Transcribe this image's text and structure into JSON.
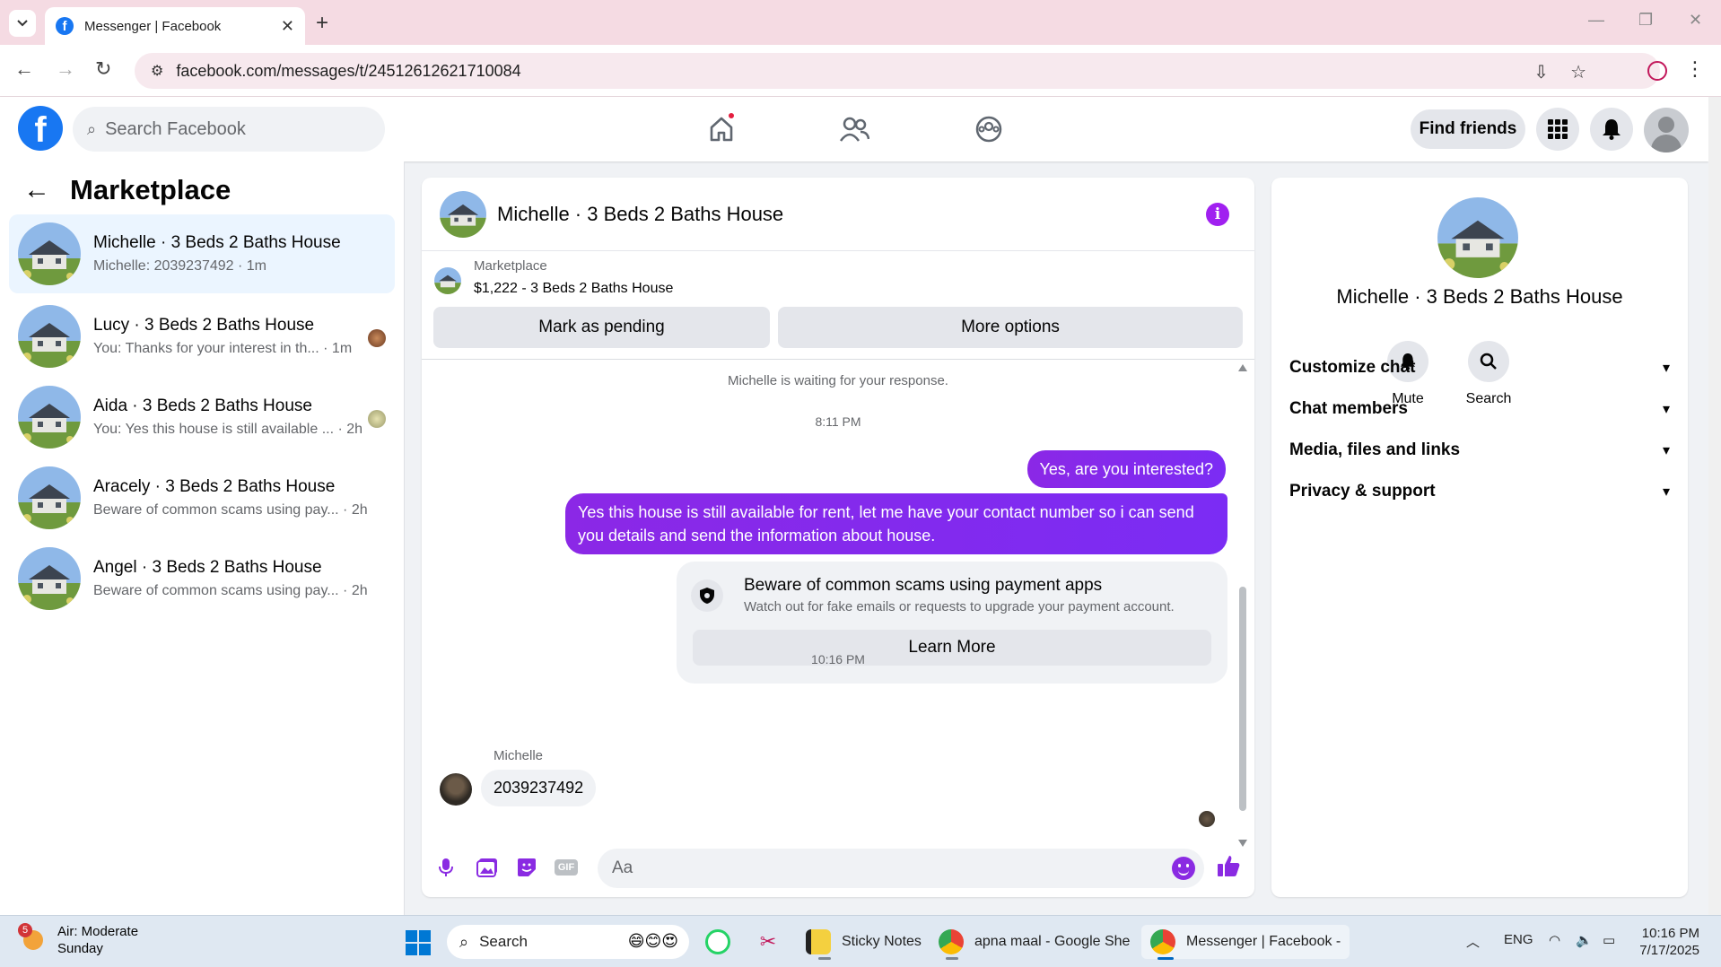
{
  "browser": {
    "tab_title": "Messenger | Facebook",
    "url": "facebook.com/messages/t/24512612621710084",
    "new_tab_glyph": "+",
    "close_glyph": "✕"
  },
  "fb_header": {
    "logo_letter": "f",
    "search_placeholder": "Search Facebook",
    "find_friends": "Find friends"
  },
  "sidebar": {
    "title": "Marketplace",
    "conversations": [
      {
        "name": "Michelle · 3 Beds 2 Baths House",
        "preview": "Michelle: 2039237492 · 1m",
        "active": true
      },
      {
        "name": "Lucy · 3 Beds 2 Baths House",
        "preview": "You: Thanks for your interest in th...",
        "time": "· 1m"
      },
      {
        "name": "Aida · 3 Beds 2 Baths House",
        "preview": "You: Yes this house is still available ...",
        "time": "· 2h"
      },
      {
        "name": "Aracely · 3 Beds 2 Baths House",
        "preview": "Beware of common scams using pay...",
        "time": "· 2h"
      },
      {
        "name": "Angel · 3 Beds 2 Baths House",
        "preview": "Beware of common scams using pay...",
        "time": "· 2h"
      }
    ]
  },
  "chat": {
    "title": "Michelle · 3 Beds 2 Baths House",
    "marketplace_label": "Marketplace",
    "listing": "$1,222 - 3 Beds 2 Baths House",
    "mark_pending": "Mark as pending",
    "more_options": "More options",
    "waiting_note": "Michelle is waiting for your response.",
    "time1": "8:11 PM",
    "msg_out_1": "Yes, are you interested?",
    "msg_out_2": "Yes this house is still available for rent, let me have your contact number so i can send you details and send the information about house.",
    "scam_title": "Beware of common scams using payment apps",
    "scam_sub": "Watch out for fake emails or requests to upgrade your payment account.",
    "learn_more": "Learn More",
    "time2": "10:16 PM",
    "sender": "Michelle",
    "msg_in": "2039237492",
    "composer_placeholder": "Aa",
    "info_glyph": "i"
  },
  "right_panel": {
    "name": "Michelle · 3 Beds 2 Baths House",
    "mute": "Mute",
    "search": "Search",
    "items": [
      "Customize chat",
      "Chat members",
      "Media, files and links",
      "Privacy & support"
    ]
  },
  "taskbar": {
    "weather_title": "Air: Moderate",
    "weather_sub": "Sunday",
    "weather_badge": "5",
    "search_label": "Search",
    "sticky_notes": "Sticky Notes",
    "sheets": "apna maal - Google She",
    "messenger": "Messenger | Facebook -",
    "lang": "ENG",
    "time": "10:16 PM",
    "date": "7/17/2025"
  },
  "icons": {
    "back": "arrow-left-icon",
    "home": "home-icon",
    "friends": "friends-icon",
    "groups": "groups-icon",
    "menu": "grid-menu-icon",
    "bell": "bell-icon",
    "mic": "microphone-icon",
    "photo": "photo-icon",
    "sticker": "sticker-icon",
    "like": "thumbs-up-icon"
  },
  "colors": {
    "fb_blue": "#1877f2",
    "messenger_purple": "#8a2be2",
    "active_row": "#ebf5ff"
  }
}
